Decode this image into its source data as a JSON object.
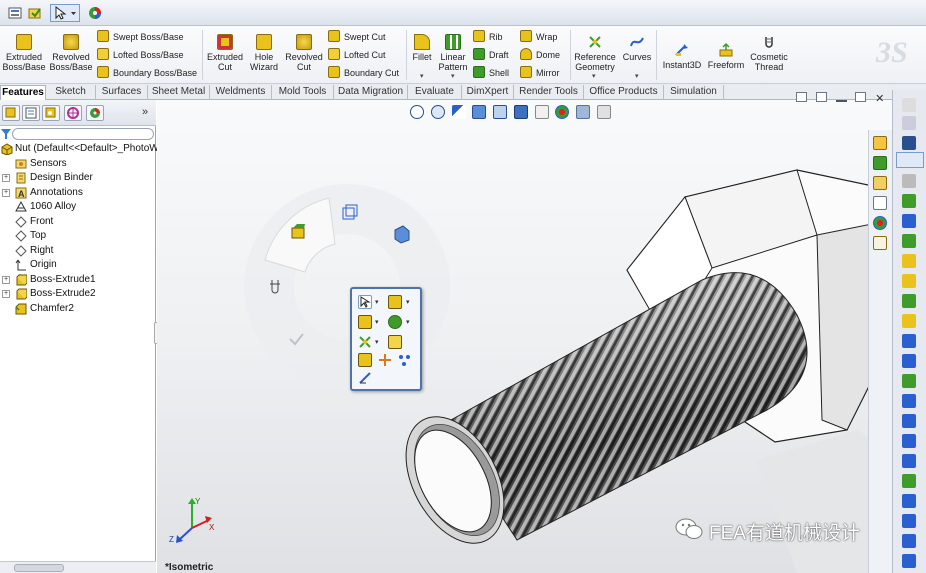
{
  "ribbon": {
    "extruded_boss": "Extruded Boss/Base",
    "revolved_boss": "Revolved Boss/Base",
    "swept_boss": "Swept Boss/Base",
    "lofted_boss": "Lofted Boss/Base",
    "boundary_boss": "Boundary Boss/Base",
    "extruded_cut": "Extruded Cut",
    "hole_wizard": "Hole Wizard",
    "revolved_cut": "Revolved Cut",
    "swept_cut": "Swept Cut",
    "lofted_cut": "Lofted Cut",
    "boundary_cut": "Boundary Cut",
    "fillet": "Fillet",
    "linear_pattern": "Linear Pattern",
    "rib": "Rib",
    "draft": "Draft",
    "shell": "Shell",
    "wrap": "Wrap",
    "dome": "Dome",
    "mirror": "Mirror",
    "reference_geometry": "Reference Geometry",
    "curves": "Curves",
    "instant3d": "Instant3D",
    "freeform": "Freeform",
    "cosmetic_thread": "Cosmetic Thread"
  },
  "tabs": [
    "Features",
    "Sketch",
    "Surfaces",
    "Sheet Metal",
    "Weldments",
    "Mold Tools",
    "Data Migration",
    "Evaluate",
    "DimXpert",
    "Render Tools",
    "Office Products",
    "Simulation"
  ],
  "tree": {
    "root": "Nut  (Default<<Default>_PhotoW",
    "items": [
      "Sensors",
      "Design Binder",
      "Annotations",
      "1060 Alloy",
      "Front",
      "Top",
      "Right",
      "Origin",
      "Boss-Extrude1",
      "Boss-Extrude2",
      "Chamfer2"
    ]
  },
  "viewport": {
    "view_label": "*Isometric",
    "watermark": "FEA有道机械设计"
  },
  "colors": {
    "accent": "#4e73a9",
    "feature_yellow": "#e8c21a",
    "feature_green": "#3f9c2b"
  }
}
